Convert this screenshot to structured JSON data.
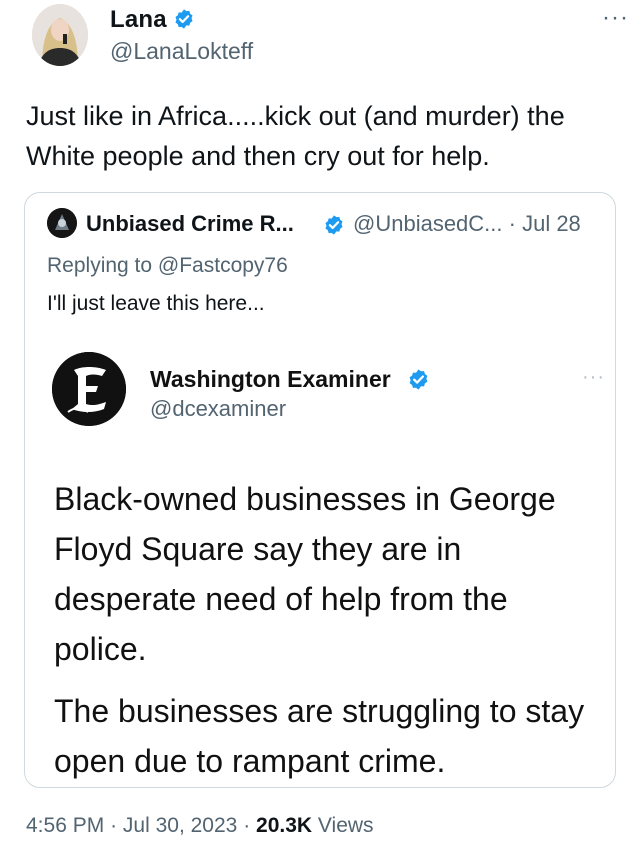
{
  "tweet": {
    "author_name": "Lana",
    "author_handle": "@LanaLokteff",
    "more_label": "···",
    "text": "Just like in Africa.....kick out (and murder) the White people and then cry out for help.",
    "time": "4:56 PM",
    "date": "Jul 30, 2023",
    "views_count": "20.3K",
    "views_label": "Views",
    "separator": "·"
  },
  "quoted": {
    "author_name": "Unbiased Crime R...",
    "author_handle": "@UnbiasedC...",
    "date_text": "· Jul 28",
    "reply_prefix": "Replying to",
    "reply_handle": "@Fastcopy76",
    "text": "I'll just leave this here...",
    "embed": {
      "author_name": "Washington Examiner",
      "author_handle": "@dcexaminer",
      "more_label": "···",
      "para1": "Black-owned businesses in George Floyd Square say they are in desperate need of help from the police.",
      "para2": "The businesses are struggling to stay open due to rampant crime."
    }
  },
  "colors": {
    "verified_blue": "#1d9bf0",
    "secondary_text": "#536471",
    "border": "#cfd9de"
  }
}
